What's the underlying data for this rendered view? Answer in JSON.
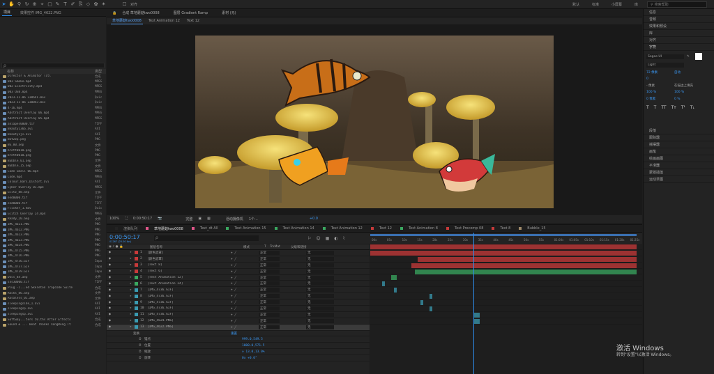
{
  "toolbar": {
    "snap_label": "对齐",
    "workspaces": [
      "默认",
      "标准",
      "小屏幕",
      "库"
    ],
    "search_placeholder": "搜索帮助"
  },
  "project_panel": {
    "tabs": [
      "项目",
      "效果控件 IMG_4622.PNG"
    ],
    "search_placeholder": "ρ",
    "col_name": "名称",
    "col_type": "类型",
    "items": [
      {
        "name": "Director & Animator  Titl",
        "type": "合成",
        "folder": true
      },
      {
        "name": "003 Smoke.mp4",
        "type": "MPEG"
      },
      {
        "name": "002 Electricity.mp4",
        "type": "MPEG"
      },
      {
        "name": "003 OSB.mp4",
        "type": "MPEG"
      },
      {
        "name": "2023-11-06 230641.mov",
        "type": "Quic"
      },
      {
        "name": "2023-11-06 230843.mov",
        "type": "Quic"
      },
      {
        "name": "4-16.mp4",
        "type": "MPEG"
      },
      {
        "name": "Abstract Overlay 06.mp4",
        "type": "MPEG"
      },
      {
        "name": "Abstract Overlay 05.mp4",
        "type": "MPEG"
      },
      {
        "name": "aniapes0000.tif",
        "type": "TIFF"
      },
      {
        "name": "Beauty1366.avi",
        "type": "AVI"
      },
      {
        "name": "Beauty1js.avi",
        "type": "AVI"
      },
      {
        "name": "BotZzp.png",
        "type": "PNG"
      },
      {
        "name": "BG_00.aep",
        "type": "文件",
        "folder": true
      },
      {
        "name": "brett0010.png",
        "type": "PNG"
      },
      {
        "name": "brett0010.png",
        "type": "PNG"
      },
      {
        "name": "Bubble_01.aep",
        "type": "文件",
        "folder": true
      },
      {
        "name": "Bubble_15.aep",
        "type": "文件",
        "folder": true
      },
      {
        "name": "Code Small 06.mp4",
        "type": "MPEG"
      },
      {
        "name": "Code.mp4",
        "type": "MPEG"
      },
      {
        "name": "Colour_Bars_Distort.avi",
        "type": "AVI"
      },
      {
        "name": "Cyber Overlay 01.mp4",
        "type": "MPEG"
      },
      {
        "name": "Glitz_88.aep",
        "type": "文件",
        "folder": true
      },
      {
        "name": "end0000.tif",
        "type": "TIFF"
      },
      {
        "name": "end0000.tif",
        "type": "TIFF"
      },
      {
        "name": "Flicker_1.mov",
        "type": "Quic"
      },
      {
        "name": "Glitch Overlay 24.mp4",
        "type": "MPEG"
      },
      {
        "name": "Ready_20.aep",
        "type": "文件",
        "folder": true
      },
      {
        "name": "IMG_4621.PNG",
        "type": "PNG"
      },
      {
        "name": "IMG_4622.PNG",
        "type": "PNG"
      },
      {
        "name": "IMG_4623.PNG",
        "type": "PNG"
      },
      {
        "name": "IMG_4623.PNG",
        "type": "PNG"
      },
      {
        "name": "IMG_4624.PNG",
        "type": "PNG"
      },
      {
        "name": "IMG_4725.PNG",
        "type": "PNG"
      },
      {
        "name": "IMG_4726.PNG",
        "type": "PNG"
      },
      {
        "name": "IMG_4736.GIF",
        "type": "Impo"
      },
      {
        "name": "IMG_4737.GIF",
        "type": "Impo"
      },
      {
        "name": "IMG_4739.GIF",
        "type": "Impo"
      },
      {
        "name": "Docs_84.aep",
        "type": "文件",
        "folder": true
      },
      {
        "name": "sns30000.tif",
        "type": "TIFF"
      },
      {
        "name": "Plug -i...ed Skeleton Trapcode Suite",
        "type": "合成",
        "folder": true
      },
      {
        "name": "Rocks_86.aep",
        "type": "文件",
        "folder": true
      },
      {
        "name": "Rosaless_01.aep",
        "type": "文件",
        "folder": true
      },
      {
        "name": "sleepingside_1.avi",
        "type": "AVI"
      },
      {
        "name": "sleepingsp.avi",
        "type": "AVI"
      },
      {
        "name": "sleepingsp.avi",
        "type": "AVI"
      },
      {
        "name": "Softway...ters  50.ths After Effects",
        "type": "合成",
        "folder": true
      },
      {
        "name": "Sound & ... Beat  Thanks  XongRong Tt",
        "type": "合成",
        "folder": true
      }
    ]
  },
  "composition": {
    "header_label": "合成 草地蘑菇two0008",
    "header_extra": "图层 Gradient Ramp",
    "header_material": "素材 (无)",
    "view_tabs": [
      "草地蘑菇two0008",
      "Text Animation 12",
      "Text 12"
    ],
    "zoom": "100%",
    "timecode": "0:00:50:17",
    "quality": "完整",
    "camera": "活动摄像机",
    "views": "1个...",
    "offset": "+0.0"
  },
  "right_panel": {
    "items": [
      "信息",
      "音频",
      "效果和预设",
      "库",
      "对齐",
      "字符",
      "段落",
      "跟踪器",
      "摇摆器",
      "画笔",
      "绘画画图",
      "平滑器",
      "蒙版插值",
      "运动草图"
    ],
    "font": "Segoe UI",
    "style": "Light",
    "size_label": "72 像素",
    "leading_label": "自动",
    "tracking_label": "0",
    "stroke_label": "- 像素",
    "stroke_mode": "在描边上填充",
    "scale_h": "100 %",
    "scale_v": "100 %",
    "baseline": "0 像素",
    "tsume": "0 %"
  },
  "timeline": {
    "tabs": [
      {
        "label": "渲染队列",
        "color": "#232323"
      },
      {
        "label": "草地蘑菇two0008",
        "color": "#e0568a"
      },
      {
        "label": "Text_dt All",
        "color": "#e0568a"
      },
      {
        "label": "Text Animation 15",
        "color": "#3aa860"
      },
      {
        "label": "Text Animation 14",
        "color": "#3aa860"
      },
      {
        "label": "Text Animation 12",
        "color": "#3aa860"
      },
      {
        "label": "Text 12",
        "color": "#c83a3a"
      },
      {
        "label": "Text Animation 8",
        "color": "#3aa860"
      },
      {
        "label": "Text Precomp 08",
        "color": "#c83a3a"
      },
      {
        "label": "Text 8",
        "color": "#c83a3a"
      },
      {
        "label": "Bubble_15",
        "color": "#a08a6a"
      }
    ],
    "timecode": "0:00:50:17",
    "fps": "01267 (25.00 fps)",
    "col_name": "图层名称",
    "col_mode": "模式",
    "col_t": "T",
    "col_trkmat": "TrkMat",
    "col_parent": "父级和链接",
    "layers": [
      {
        "num": "1",
        "name": "[颜色遮罩]",
        "mode": "正常",
        "parent": "无",
        "color": "#c83a3a"
      },
      {
        "num": "2",
        "name": "[颜色遮罩]",
        "mode": "正常",
        "parent": "无",
        "color": "#c83a3a"
      },
      {
        "num": "3",
        "name": "[Text 8]",
        "mode": "正常",
        "parent": "无",
        "color": "#c83a3a"
      },
      {
        "num": "4",
        "name": "[Text 6]",
        "mode": "正常",
        "parent": "无",
        "color": "#c83a3a"
      },
      {
        "num": "5",
        "name": "[Text Animation 12]",
        "mode": "正常",
        "parent": "无",
        "color": "#3aa860"
      },
      {
        "num": "6",
        "name": "[Text Animation 24]",
        "mode": "正常",
        "parent": "无",
        "color": "#3aa860"
      },
      {
        "num": "7",
        "name": "[IMG_4736.GIF]",
        "mode": "正常",
        "parent": "无",
        "color": "#3a9ab0"
      },
      {
        "num": "8",
        "name": "[IMG_4736.GIF]",
        "mode": "正常",
        "parent": "无",
        "color": "#3a9ab0"
      },
      {
        "num": "9",
        "name": "[IMG_4736.GIF]",
        "mode": "正常",
        "parent": "无",
        "color": "#3a9ab0"
      },
      {
        "num": "10",
        "name": "[IMG_4736.GIF]",
        "mode": "正常",
        "parent": "无",
        "color": "#3a9ab0"
      },
      {
        "num": "11",
        "name": "[IMG_4736.GIF]",
        "mode": "正常",
        "parent": "无",
        "color": "#3a9ab0"
      },
      {
        "num": "12",
        "name": "[IMG_4624.PNG]",
        "mode": "正常",
        "parent": "无",
        "color": "#3a9ab0"
      },
      {
        "num": "13",
        "name": "[IMG_4622.PNG]",
        "mode": "正常",
        "parent": "无",
        "color": "#3a9ab0"
      }
    ],
    "transform_label": "变换",
    "reset_label": "重置",
    "props": [
      {
        "name": "锚点",
        "value": "999.0,549.5"
      },
      {
        "name": "位置",
        "value": "1000.0,571.5"
      },
      {
        "name": "缩放",
        "value": "∞ 13.0,13.0%"
      },
      {
        "name": "旋转",
        "value": "0x +0.0°"
      }
    ],
    "ruler_ticks": [
      "00s",
      "05s",
      "10s",
      "15s",
      "20s",
      "25s",
      "30s",
      "35s",
      "40s",
      "45s",
      "50s",
      "55s",
      "01:00s",
      "01:05s",
      "01:10s",
      "01:15s",
      "01:20s",
      "01:25s"
    ]
  },
  "watermark": {
    "line1": "激活 Windows",
    "line2": "转到\"设置\"以激活 Windows。"
  }
}
